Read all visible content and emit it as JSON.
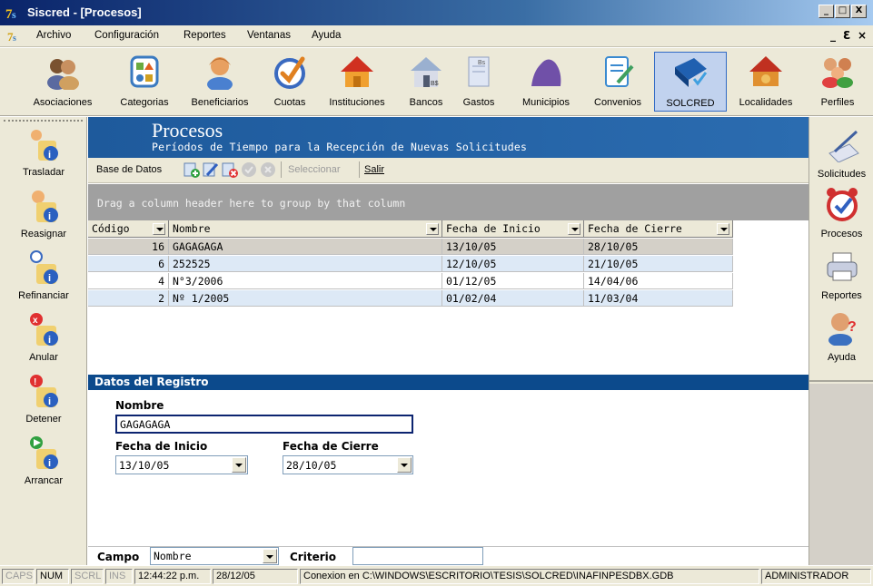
{
  "window": {
    "title": "Siscred - [Procesos]",
    "min": "_",
    "max": "□",
    "close": "X"
  },
  "menu": {
    "items": [
      "Archivo",
      "Configuración",
      "Reportes",
      "Ventanas",
      "Ayuda"
    ],
    "mdi_min": "_",
    "mdi_restore": "Ɛ",
    "mdi_close": "×"
  },
  "toolbar": {
    "buttons": [
      {
        "label": "Asociaciones",
        "icon": "people-icon"
      },
      {
        "label": "Categorias",
        "icon": "categories-icon"
      },
      {
        "label": "Beneficiarios",
        "icon": "person-icon"
      },
      {
        "label": "Cuotas",
        "icon": "check-disc-icon"
      },
      {
        "label": "Instituciones",
        "icon": "house-icon"
      },
      {
        "label": "Bancos",
        "icon": "bank-icon"
      },
      {
        "label": "Gastos",
        "icon": "expenses-icon"
      },
      {
        "label": "Municipios",
        "icon": "map-icon"
      },
      {
        "label": "Convenios",
        "icon": "agreement-icon"
      },
      {
        "label": "SOLCRED",
        "icon": "book-icon"
      },
      {
        "label": "Localidades",
        "icon": "village-icon"
      },
      {
        "label": "Perfiles",
        "icon": "profiles-icon"
      }
    ]
  },
  "left_sidebar": {
    "items": [
      {
        "label": "Trasladar"
      },
      {
        "label": "Reasignar"
      },
      {
        "label": "Refinanciar"
      },
      {
        "label": "Anular"
      },
      {
        "label": "Detener"
      },
      {
        "label": "Arrancar"
      }
    ]
  },
  "right_sidebar": {
    "items": [
      {
        "label": "Solicitudes"
      },
      {
        "label": "Procesos"
      },
      {
        "label": "Reportes"
      },
      {
        "label": "Ayuda"
      }
    ]
  },
  "header": {
    "title": "Procesos",
    "subtitle": "Períodos de Tiempo para la Recepción de Nuevas Solicitudes"
  },
  "subtoolbar": {
    "label": "Base de Datos",
    "select": "Seleccionar",
    "exit": "Salir"
  },
  "grid": {
    "group_hint": "Drag a column header here to group by that column",
    "columns": [
      "Código",
      "Nombre",
      "Fecha de Inicio",
      "Fecha de Cierre"
    ],
    "rows": [
      {
        "codigo": "16",
        "nombre": "GAGAGAGA",
        "inicio": "13/10/05",
        "cierre": "28/10/05"
      },
      {
        "codigo": "6",
        "nombre": "252525",
        "inicio": "12/10/05",
        "cierre": "21/10/05"
      },
      {
        "codigo": "4",
        "nombre": "N°3/2006",
        "inicio": "01/12/05",
        "cierre": "14/04/06"
      },
      {
        "codigo": "2",
        "nombre": "Nº 1/2005",
        "inicio": "01/02/04",
        "cierre": "11/03/04"
      }
    ]
  },
  "form": {
    "section_title": "Datos del Registro",
    "nombre_label": "Nombre",
    "nombre_value": "GAGAGAGA",
    "inicio_label": "Fecha de Inicio",
    "inicio_value": "13/10/05",
    "cierre_label": "Fecha de Cierre",
    "cierre_value": "28/10/05"
  },
  "filter": {
    "campo_label": "Campo",
    "campo_value": "Nombre",
    "criterio_label": "Criterio",
    "criterio_value": ""
  },
  "statusbar": {
    "caps": "CAPS",
    "num": "NUM",
    "scrl": "SCRL",
    "ins": "INS",
    "time": "12:44:22 p.m.",
    "date": "28/12/05",
    "connection": "Conexion en C:\\WINDOWS\\ESCRITORIO\\TESIS\\SOLCRED\\INAFINPESDBX.GDB",
    "user": "ADMINISTRADOR"
  }
}
